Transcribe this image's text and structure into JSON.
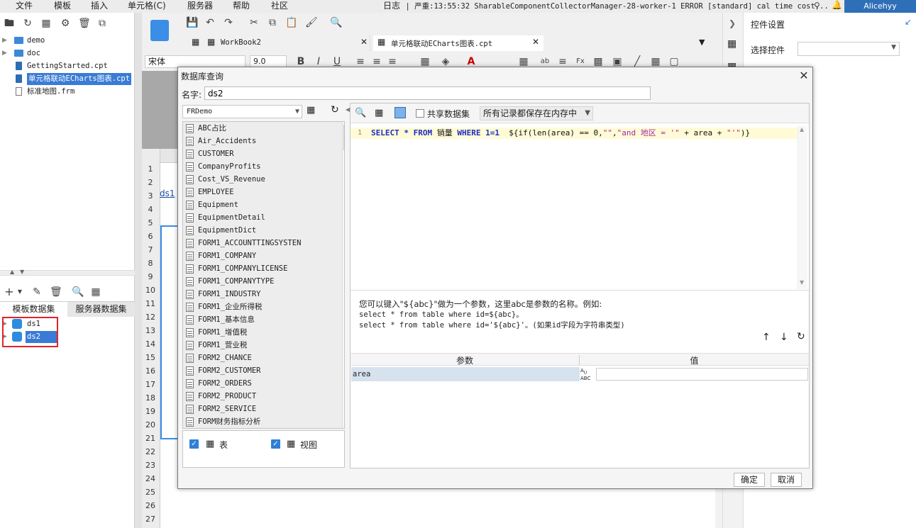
{
  "menubar": {
    "items": [
      "文件",
      "模板",
      "插入",
      "单元格(C)",
      "服务器",
      "帮助",
      "社区"
    ],
    "log_label": "日志",
    "log_message": "| 严重:13:55:32 SharableComponentCollectorManager-28-worker-1 ERROR [standard] cal time cost...",
    "user": "Alicehyy"
  },
  "left_panel": {
    "tree": [
      {
        "label": "demo",
        "type": "folder"
      },
      {
        "label": "doc",
        "type": "folder"
      },
      {
        "label": "GettingStarted.cpt",
        "type": "cpt"
      },
      {
        "label": "单元格联动ECharts图表.cpt",
        "type": "cpt",
        "selected": true
      },
      {
        "label": "标准地图.frm",
        "type": "frm"
      }
    ],
    "ds_tabs": [
      "模板数据集",
      "服务器数据集"
    ],
    "datasets": [
      "ds1",
      "ds2"
    ]
  },
  "center": {
    "tabs": [
      "WorkBook2",
      "单元格联动ECharts图表.cpt"
    ],
    "font": "宋体",
    "font_size": "9.0",
    "cell_ds1": "ds1",
    "row_numbers": [
      "1",
      "2",
      "3",
      "4",
      "5",
      "6",
      "7",
      "8",
      "9",
      "10",
      "11",
      "12",
      "13",
      "14",
      "15",
      "16",
      "17",
      "18",
      "19",
      "20",
      "21",
      "22",
      "23",
      "24",
      "25",
      "26",
      "27"
    ]
  },
  "right_panel": {
    "title": "控件设置",
    "select_label": "选择控件"
  },
  "dialog": {
    "title": "数据库查询",
    "name_label": "名字:",
    "name_value": "ds2",
    "connection": "FRDemo",
    "tables": [
      "ABC占比",
      "Air_Accidents",
      "CUSTOMER",
      "CompanyProfits",
      "Cost_VS_Revenue",
      "EMPLOYEE",
      "Equipment",
      "EquipmentDetail",
      "EquipmentDict",
      "FORM1_ACCOUNTTINGSYSTEN",
      "FORM1_COMPANY",
      "FORM1_COMPANYLICENSE",
      "FORM1_COMPANYTYPE",
      "FORM1_INDUSTRY",
      "FORM1_企业所得税",
      "FORM1_基本信息",
      "FORM1_增值税",
      "FORM1_营业税",
      "FORM2_CHANCE",
      "FORM2_CUSTOMER",
      "FORM2_ORDERS",
      "FORM2_PRODUCT",
      "FORM2_SERVICE",
      "FORM财务指标分析"
    ],
    "filter_table_label": "表",
    "filter_view_label": "视图",
    "share_label": "共享数据集",
    "memory_option": "所有记录都保存在内存中",
    "sql_line_number": "1",
    "sql_parts": {
      "select": "SELECT",
      "star": "*",
      "from": "FROM",
      "table": "销量",
      "where": "WHERE",
      "cond": "1=1",
      "expr1": "${if(len(area) == 0,",
      "str1": "\"\"",
      "comma": ",",
      "str2": "\"and 地区 = '\"",
      "plus": " + area + ",
      "str3": "\"'\"",
      "close": ")}"
    },
    "hint_lines": [
      "您可以键入\"${abc}\"做为一个参数，这里abc是参数的名称。例如:",
      "select * from table where id=${abc}。",
      "select * from table where id='${abc}'。(如果id字段为字符串类型)"
    ],
    "param_header": "参数",
    "value_header": "值",
    "param_name": "area",
    "ok_label": "确定",
    "cancel_label": "取消"
  }
}
